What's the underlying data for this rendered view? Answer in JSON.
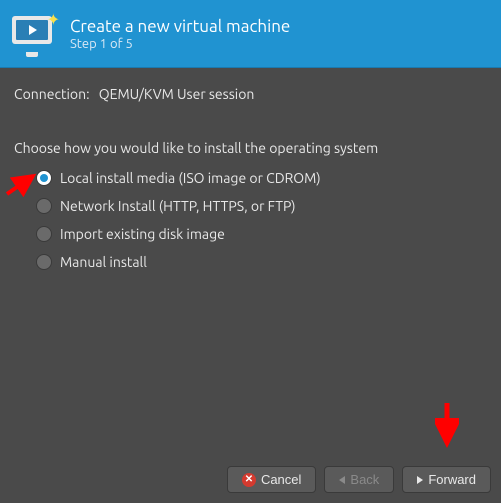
{
  "header": {
    "title": "Create a new virtual machine",
    "subtitle": "Step 1 of 5"
  },
  "connection": {
    "label": "Connection:",
    "value": "QEMU/KVM User session"
  },
  "prompt": "Choose how you would like to install the operating system",
  "options": [
    {
      "label": "Local install media (ISO image or CDROM)",
      "selected": true
    },
    {
      "label": "Network Install (HTTP, HTTPS, or FTP)",
      "selected": false
    },
    {
      "label": "Import existing disk image",
      "selected": false
    },
    {
      "label": "Manual install",
      "selected": false
    }
  ],
  "buttons": {
    "cancel": "Cancel",
    "back": "Back",
    "forward": "Forward"
  },
  "annotations": {
    "arrow_color": "#ff0000"
  }
}
